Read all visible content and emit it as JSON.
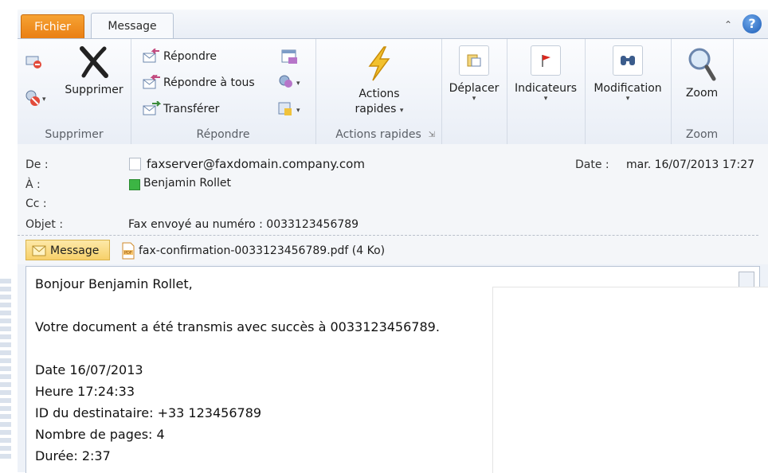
{
  "tabs": {
    "file": "Fichier",
    "message": "Message"
  },
  "ribbon": {
    "delete_group": {
      "delete_label": "Supprimer",
      "group_label": "Supprimer"
    },
    "reply_group": {
      "reply": "Répondre",
      "reply_all": "Répondre à tous",
      "forward": "Transférer",
      "group_label": "Répondre"
    },
    "quick_group": {
      "label_line1": "Actions",
      "label_line2": "rapides",
      "group_label": "Actions rapides"
    },
    "move_group": {
      "label": "Déplacer"
    },
    "tags_group": {
      "label": "Indicateurs"
    },
    "edit_group": {
      "label": "Modification"
    },
    "zoom_group": {
      "label": "Zoom",
      "group_label": "Zoom"
    }
  },
  "header": {
    "from_label": "De :",
    "from_value": "faxserver@faxdomain.company.com",
    "to_label": "À :",
    "to_value": "Benjamin Rollet",
    "cc_label": "Cc :",
    "subject_label": "Objet :",
    "subject_value": "Fax envoyé au numéro : 0033123456789",
    "date_label": "Date :",
    "date_value": "mar. 16/07/2013 17:27"
  },
  "message_bar": {
    "message_tab": "Message",
    "attachment": "fax-confirmation-0033123456789.pdf (4 Ko)"
  },
  "body": {
    "greeting": "Bonjour Benjamin Rollet,",
    "success": "Votre document a été transmis avec succès à 0033123456789.",
    "date_line": "Date 16/07/2013",
    "time_line": "Heure 17:24:33",
    "recipient_line": "ID du destinataire: +33 123456789",
    "pages_line": "Nombre de pages: 4",
    "duration_line": "Durée: 2:37"
  },
  "colors": {
    "file_tab": "#e97e12",
    "accent": "#1c5cb6",
    "ribbon_bg": "#eef2f8"
  }
}
